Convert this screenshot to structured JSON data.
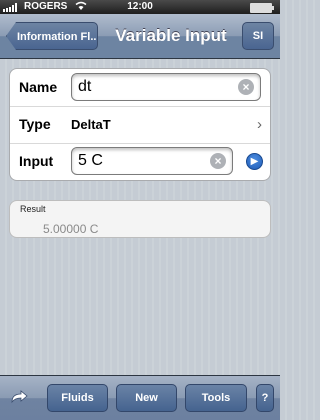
{
  "status_bar": {
    "carrier": "ROGERS",
    "time": "12:00"
  },
  "nav": {
    "back_label": "Information Fl...",
    "title": "Variable Input",
    "right_label": "SI"
  },
  "form": {
    "name_label": "Name",
    "name_value": "dt",
    "type_label": "Type",
    "type_value": "DeltaT",
    "input_label": "Input",
    "input_value": "5 C"
  },
  "result": {
    "label": "Result",
    "value": "5.00000 C"
  },
  "toolbar": {
    "fluids_label": "Fluids",
    "new_label": "New",
    "tools_label": "Tools",
    "help_label": "?"
  },
  "icons": {
    "wifi": "wifi-icon",
    "battery": "battery-icon",
    "clear": "clear-icon",
    "chevron": "chevron-right-icon",
    "go": "go-arrow-icon",
    "share": "share-icon"
  },
  "colors": {
    "accent_blue": "#1f5db8",
    "nav_bar": "#6d84a2"
  }
}
